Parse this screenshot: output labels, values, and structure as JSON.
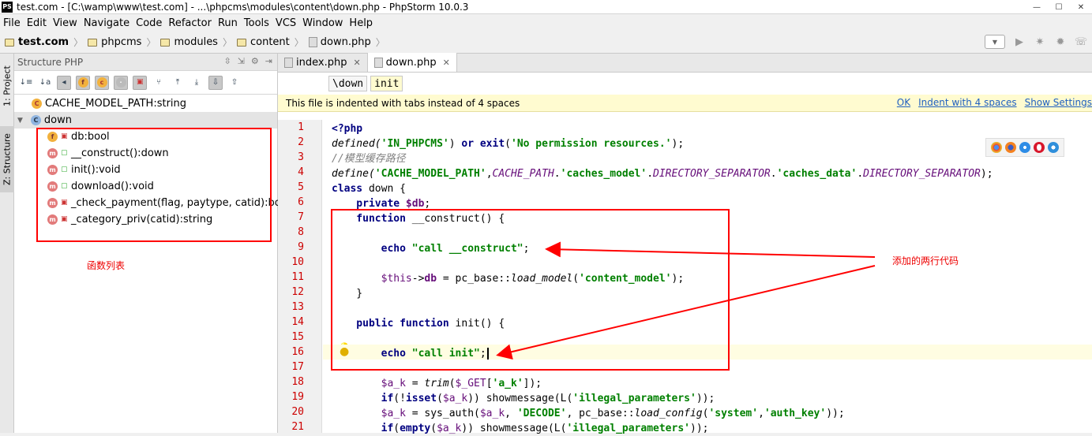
{
  "window": {
    "title": "test.com - [C:\\wamp\\www\\test.com] - ...\\phpcms\\modules\\content\\down.php - PhpStorm 10.0.3",
    "logo": "PS"
  },
  "menu": [
    "File",
    "Edit",
    "View",
    "Navigate",
    "Code",
    "Refactor",
    "Run",
    "Tools",
    "VCS",
    "Window",
    "Help"
  ],
  "breadcrumbs": [
    "test.com",
    "phpcms",
    "modules",
    "content",
    "down.php"
  ],
  "sidebar_tabs": {
    "project": "1: Project",
    "structure": "Z: Structure"
  },
  "structure": {
    "title": "Structure PHP",
    "constant": "CACHE_MODEL_PATH:string",
    "class_name": "down",
    "members": [
      {
        "icon": "f",
        "label": "db:bool",
        "lock": "red"
      },
      {
        "icon": "m",
        "label": "__construct():down",
        "lock": "green"
      },
      {
        "icon": "m",
        "label": "init():void",
        "lock": "green"
      },
      {
        "icon": "m",
        "label": "download():void",
        "lock": "green"
      },
      {
        "icon": "m",
        "label": "_check_payment(flag, paytype, catid):bool",
        "lock": "red"
      },
      {
        "icon": "m",
        "label": "_category_priv(catid):string",
        "lock": "red"
      }
    ]
  },
  "annotations": {
    "function_list": "函数列表",
    "added_lines": "添加的两行代码"
  },
  "editor": {
    "tabs": [
      {
        "label": "index.php",
        "active": false
      },
      {
        "label": "down.php",
        "active": true
      }
    ],
    "crumbs": [
      "\\down",
      "init"
    ],
    "notice": "This file is indented with tabs instead of 4 spaces",
    "notice_links": [
      "OK",
      "Indent with 4 spaces",
      "Show Settings"
    ],
    "line_numbers": [
      "1",
      "2",
      "3",
      "4",
      "5",
      "6",
      "7",
      "8",
      "9",
      "10",
      "11",
      "12",
      "13",
      "14",
      "15",
      "16",
      "17",
      "18",
      "19",
      "20",
      "21"
    ],
    "code": {
      "l1": "<?php",
      "l2a": "defined(",
      "l2b": "'IN_PHPCMS'",
      "l2c": ") ",
      "l2d": "or exit",
      "l2e": "(",
      "l2f": "'No permission resources.'",
      "l2g": ");",
      "l3": "//模型缓存路径",
      "l4a": "define(",
      "l4b": "'CACHE_MODEL_PATH'",
      "l4c": ",",
      "l4d": "CACHE_PATH",
      "l4e": ".",
      "l4f": "'caches_model'",
      "l4g": ".",
      "l4h": "DIRECTORY_SEPARATOR",
      "l4i": ".",
      "l4j": "'caches_data'",
      "l4k": ".",
      "l4l": "DIRECTORY_SEPARATOR",
      "l4m": ");",
      "l5a": "class",
      "l5b": " down {",
      "l6a": "    private ",
      "l6b": "$db",
      "l6c": ";",
      "l7a": "    function",
      "l7b": " __construct() {",
      "l9a": "        echo ",
      "l9b": "\"call __construct\"",
      "l9c": ";",
      "l11a": "        $this",
      "l11b": "->",
      "l11c": "db",
      "l11d": " = pc_base::",
      "l11e": "load_model",
      "l11f": "(",
      "l11g": "'content_model'",
      "l11h": ");",
      "l12": "    }",
      "l14a": "    public function",
      "l14b": " init() {",
      "l16a": "        echo ",
      "l16b": "\"call init\"",
      "l16c": ";",
      "l18a": "        $a_k",
      "l18b": " = ",
      "l18c": "trim",
      "l18d": "(",
      "l18e": "$_GET",
      "l18f": "[",
      "l18g": "'a_k'",
      "l18h": "]);",
      "l19a": "        if",
      "l19b": "(!",
      "l19c": "isset",
      "l19d": "(",
      "l19e": "$a_k",
      "l19f": ")) showmessage(L(",
      "l19g": "'illegal_parameters'",
      "l19h": "));",
      "l20a": "        $a_k",
      "l20b": " = sys_auth(",
      "l20c": "$a_k",
      "l20d": ", ",
      "l20e": "'DECODE'",
      "l20f": ", pc_base::",
      "l20g": "load_config",
      "l20h": "(",
      "l20i": "'system'",
      "l20j": ",",
      "l20k": "'auth_key'",
      "l20l": "));",
      "l21a": "        if",
      "l21b": "(",
      "l21c": "empty",
      "l21d": "(",
      "l21e": "$a_k",
      "l21f": ")) showmessage(L(",
      "l21g": "'illegal_parameters'",
      "l21h": "));"
    }
  }
}
